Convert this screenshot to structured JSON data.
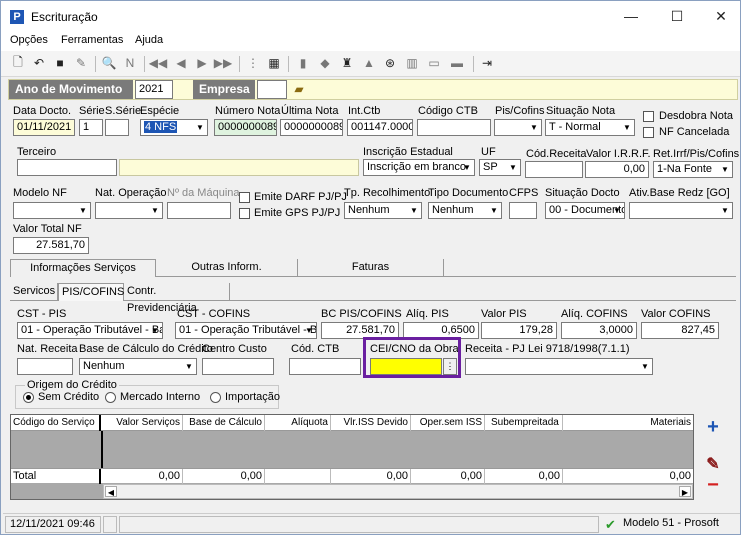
{
  "window": {
    "title": "Escrituração",
    "minimize": "—",
    "maximize": "☐",
    "close": "✕"
  },
  "menu": [
    "Opções",
    "Ferramentas",
    "Ajuda"
  ],
  "yearbar": {
    "year_label": "Ano de Movimento",
    "year_value": "2021",
    "company_label": "Empresa"
  },
  "row1": {
    "data_docto_label": "Data Docto.",
    "data_docto": "01/11/2021",
    "serie_label": "Série",
    "serie": "1",
    "sserie_label": "S.Série",
    "sserie": "",
    "especie_label": "Espécie",
    "especie": "4 NFS",
    "numero_label": "Número Nota",
    "numero": "0000000089",
    "ultima_label": "Última Nota",
    "ultima": "0000000089",
    "intctb_label": "Int.Ctb",
    "intctb": "001147.0000",
    "codctb_label": "Código CTB",
    "codctb": "",
    "piscofins_label": "Pis/Cofins",
    "piscofins": "",
    "situacao_label": "Situação Nota",
    "situacao": "T - Normal",
    "desdobra_label": "Desdobra Nota",
    "cancelada_label": "NF Cancelada"
  },
  "row2": {
    "terceiro_label": "Terceiro",
    "terceiro_cod": "",
    "terceiro_nome": "",
    "ie_label": "Inscrição Estadual",
    "ie": "Inscrição em branco",
    "uf_label": "UF",
    "uf": "SP",
    "codreceita_label": "Cód.Receita",
    "codreceita": "",
    "irrf_label": "Valor I.R.R.F.",
    "irrf": "0,00",
    "retirrf_label": "Ret.Irrf/Pis/Cofins",
    "retirrf": "1-Na Fonte"
  },
  "row3": {
    "modelo_label": "Modelo NF",
    "modelo": "",
    "natop_label": "Nat. Operação",
    "natop": "",
    "maquina_label": "Nº da Máquina",
    "maquina": "",
    "darf_label": "Emite DARF PJ/PJ",
    "gps_label": "Emite GPS PJ/PJ",
    "tprec_label": "Tp. Recolhimento",
    "tprec": "Nenhum",
    "tpdoc_label": "Tipo Documento",
    "tpdoc": "Nenhum",
    "cfps_label": "CFPS",
    "cfps": "",
    "sitdocto_label": "Situação Docto",
    "sitdocto": "00 - Documento",
    "ativbase_label": "Ativ.Base Redz [GO]",
    "ativbase": ""
  },
  "total": {
    "label": "Valor Total NF",
    "value": "27.581,70"
  },
  "tabs": [
    "Informações Serviços",
    "Outras Inform.",
    "Faturas"
  ],
  "subtabs": [
    "Servicos",
    "PIS/COFINS",
    "Contr. Previdenciária"
  ],
  "pis": {
    "cstpis_label": "CST - PIS",
    "cstpis": "01 - Operação Tributável - Base",
    "cstcofins_label": "CST - COFINS",
    "cstcofins": "01 - Operação Tributável - Base",
    "bc_label": "BC PIS/COFINS",
    "bc": "27.581,70",
    "aliqpis_label": "Alíq. PIS",
    "aliqpis": "0,6500",
    "valpis_label": "Valor PIS",
    "valpis": "179,28",
    "aliqcofins_label": "Alíq. COFINS",
    "aliqcofins": "3,0000",
    "valcofins_label": "Valor COFINS",
    "valcofins": "827,45",
    "natrec_label": "Nat. Receita",
    "natrec": "",
    "basecalc_label": "Base de Cálculo do Crédito",
    "basecalc": "Nenhum",
    "centro_label": "Centro Custo",
    "centro": "",
    "codctb_label": "Cód. CTB",
    "codctb": "",
    "cei_label": "CEI/CNO da Obra",
    "cei": "",
    "receita_label": "Receita - PJ Lei 9718/1998(7.1.1)",
    "receita": ""
  },
  "origem": {
    "label": "Origem do Crédito",
    "options": [
      "Sem Crédito",
      "Mercado Interno",
      "Importação"
    ],
    "selected": 0
  },
  "grid": {
    "headers": [
      "Código do Serviço",
      "Valor Serviços",
      "Base de Cálculo",
      "Alíquota",
      "Vlr.ISS Devido",
      "Oper.sem ISS",
      "Subempreitada",
      "Materiais"
    ],
    "total_label": "Total",
    "totals": [
      "0,00",
      "0,00",
      "0,00",
      "0,00",
      "0,00",
      "0,00"
    ]
  },
  "status": {
    "datetime": "12/11/2021  09:46",
    "model": "Modelo 51 - Prosoft"
  },
  "colors": {
    "highlight_box": "#6a1fa0",
    "yellow": "#ffff00",
    "light_yellow": "#fdfcd8",
    "add": "#1e56b4",
    "remove": "#d42020"
  }
}
